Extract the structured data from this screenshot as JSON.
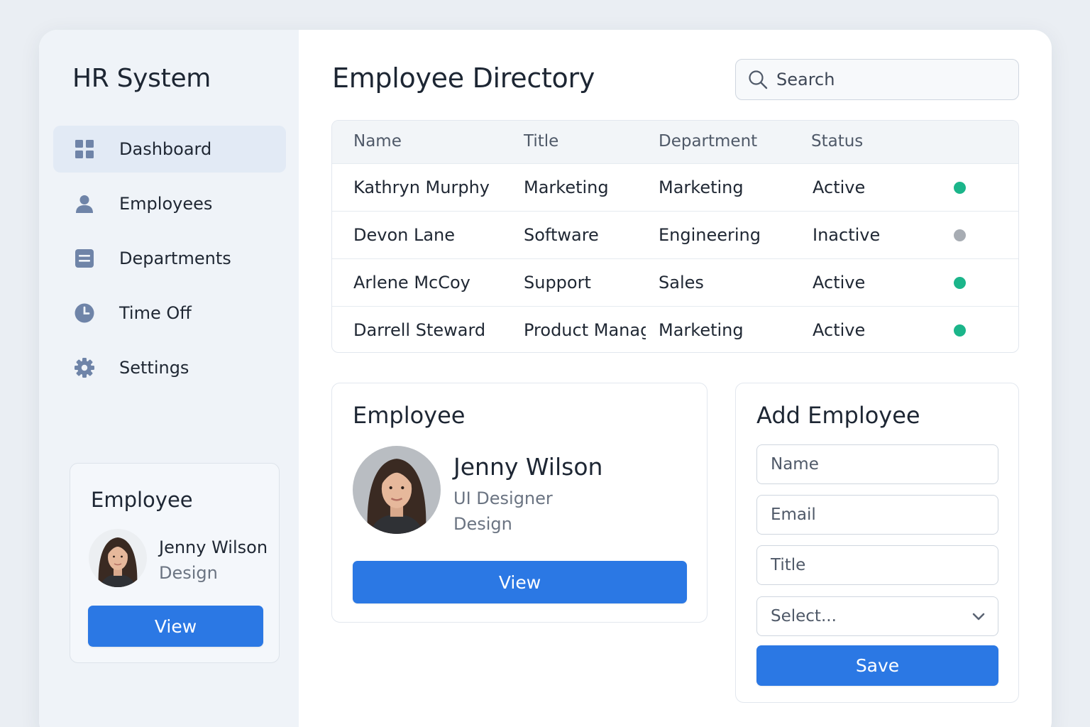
{
  "app": {
    "title": "HR System"
  },
  "sidebar": {
    "items": [
      {
        "label": "Dashboard",
        "icon": "grid-icon",
        "active": true
      },
      {
        "label": "Employees",
        "icon": "person-icon",
        "active": false
      },
      {
        "label": "Departments",
        "icon": "list-icon",
        "active": false
      },
      {
        "label": "Time Off",
        "icon": "clock-icon",
        "active": false
      },
      {
        "label": "Settings",
        "icon": "gear-icon",
        "active": false
      }
    ],
    "card": {
      "title": "Employee",
      "name": "Jenny Wilson",
      "department": "Design",
      "button_label": "View"
    }
  },
  "main": {
    "title": "Employee Directory",
    "search": {
      "placeholder": "Search"
    },
    "table": {
      "columns": [
        "Name",
        "Title",
        "Department",
        "Status"
      ],
      "rows": [
        {
          "name": "Kathryn Murphy",
          "title": "Marketing",
          "department": "Marketing",
          "status": "Active",
          "status_color": "#1bb58a"
        },
        {
          "name": "Devon Lane",
          "title": "Software",
          "department": "Engineering",
          "status": "Inactive",
          "status_color": "#a7acb3"
        },
        {
          "name": "Arlene McCoy",
          "title": "Support",
          "department": "Sales",
          "status": "Active",
          "status_color": "#1bb58a"
        },
        {
          "name": "Darrell Steward",
          "title": "Product Manag",
          "department": "Marketing",
          "status": "Active",
          "status_color": "#1bb58a"
        }
      ]
    },
    "employee_card": {
      "title": "Employee",
      "name": "Jenny Wilson",
      "role": "UI Designer",
      "department": "Design",
      "button_label": "View"
    },
    "add_employee": {
      "title": "Add Employee",
      "name_placeholder": "Name",
      "email_placeholder": "Email",
      "title_placeholder": "Title",
      "select_value": "Select...",
      "save_label": "Save"
    }
  },
  "colors": {
    "accent": "#2b78e4",
    "active": "#1bb58a",
    "inactive": "#a7acb3",
    "sidebar_bg": "#eff3f8",
    "icon": "#6f84a8"
  }
}
